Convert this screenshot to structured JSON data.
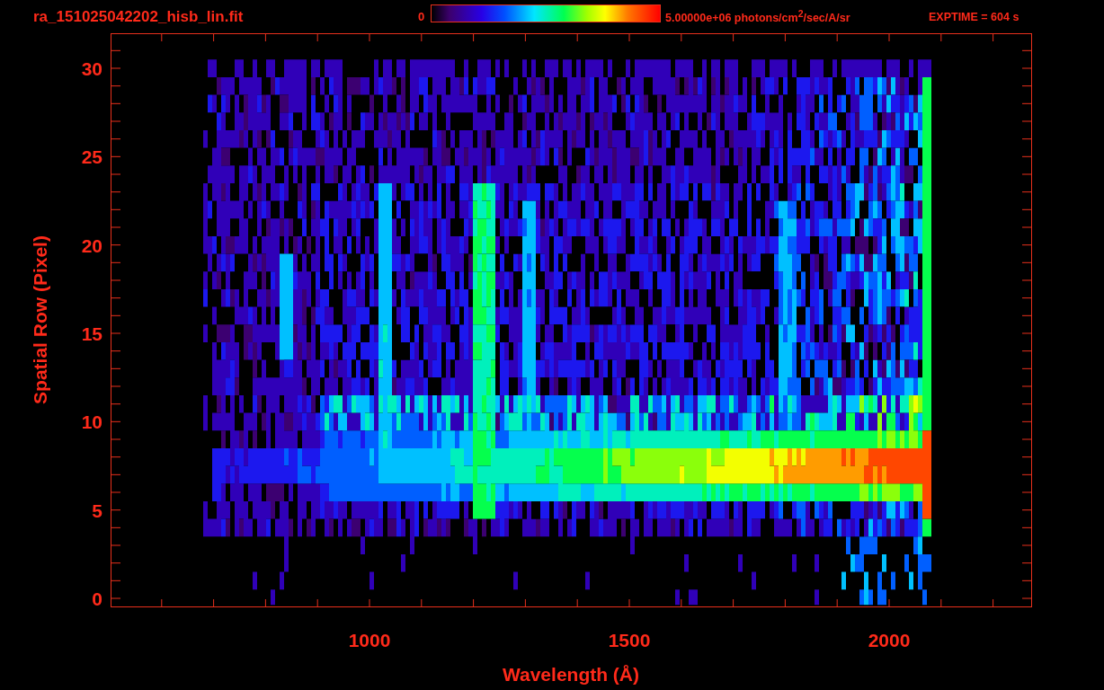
{
  "title": "ra_151025042202_hisb_lin.fit",
  "colorbar": {
    "min_label": "0",
    "max_label": "5.00000e+06 photons/cm$^{2}$/sec/A/sr"
  },
  "exposure": "EXPTIME = 604 s",
  "plot": {
    "xlabel": "Wavelength (Å)",
    "ylabel": "Spatial Row (Pixel)",
    "xticks": [
      "1000",
      "1500",
      "2000"
    ],
    "yticks": [
      "30",
      "25",
      "20",
      "15",
      "10",
      "5",
      "0"
    ]
  }
}
